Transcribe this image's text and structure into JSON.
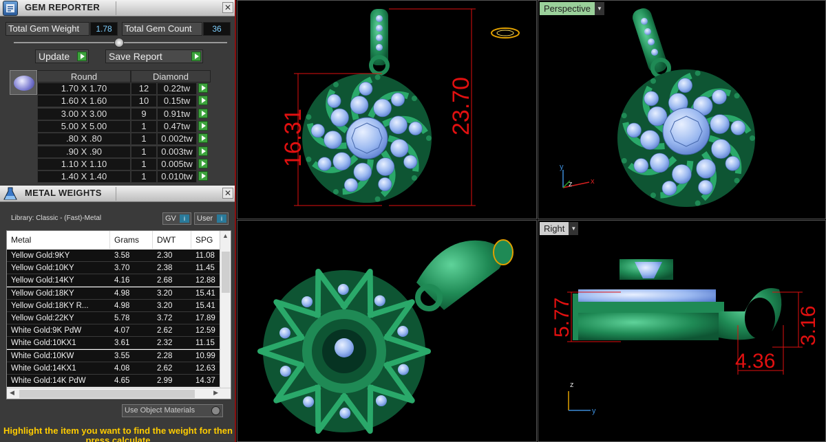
{
  "gem_reporter": {
    "title": "GEM REPORTER",
    "total_weight_label": "Total Gem Weight",
    "total_weight_value": "1.78",
    "total_count_label": "Total Gem Count",
    "total_count_value": "36",
    "update_label": "Update",
    "save_label": "Save Report",
    "shape_header": "Round",
    "type_header": "Diamond",
    "rows": [
      {
        "size": "1.70 X 1.70",
        "count": "12",
        "weight": "0.22tw"
      },
      {
        "size": "1.60 X 1.60",
        "count": "10",
        "weight": "0.15tw"
      },
      {
        "size": "3.00 X 3.00",
        "count": "9",
        "weight": "0.91tw"
      },
      {
        "size": "5.00 X 5.00",
        "count": "1",
        "weight": "0.47tw"
      },
      {
        "size": ".80 X .80",
        "count": "1",
        "weight": "0.002tw"
      },
      {
        "size": ".90 X .90",
        "count": "1",
        "weight": "0.003tw"
      },
      {
        "size": "1.10 X 1.10",
        "count": "1",
        "weight": "0.005tw"
      },
      {
        "size": "1.40 X 1.40",
        "count": "1",
        "weight": "0.010tw"
      }
    ]
  },
  "metal_weights": {
    "title": "METAL WEIGHTS",
    "library": "Library: Classic - (Fast)-Metal",
    "gv_label": "GV",
    "user_label": "User",
    "headers": [
      "Metal",
      "Grams",
      "DWT",
      "SPG"
    ],
    "rows": [
      [
        "Yellow Gold:9KY",
        "3.58",
        "2.30",
        "11.08"
      ],
      [
        "Yellow Gold:10KY",
        "3.70",
        "2.38",
        "11.45"
      ],
      [
        "Yellow Gold:14KY",
        "4.16",
        "2.68",
        "12.88"
      ],
      [
        "Yellow Gold:18KY",
        "4.98",
        "3.20",
        "15.41"
      ],
      [
        "Yellow Gold:18KY R...",
        "4.98",
        "3.20",
        "15.41"
      ],
      [
        "Yellow Gold:22KY",
        "5.78",
        "3.72",
        "17.89"
      ],
      [
        "White Gold:9K PdW",
        "4.07",
        "2.62",
        "12.59"
      ],
      [
        "White Gold:10KX1",
        "3.61",
        "2.32",
        "11.15"
      ],
      [
        "White Gold:10KW",
        "3.55",
        "2.28",
        "10.99"
      ],
      [
        "White Gold:14KX1",
        "4.08",
        "2.62",
        "12.63"
      ],
      [
        "White Gold:14K PdW",
        "4.65",
        "2.99",
        "14.37"
      ]
    ],
    "use_object_label": "Use Object Materials",
    "hint": "Highlight the item you want to find the weight for then press calculate"
  },
  "viewports": {
    "top": {
      "dim_left": "16.31",
      "dim_right": "23.70"
    },
    "perspective": {
      "label": "Perspective",
      "axis_x": "x",
      "axis_y": "y",
      "axis_z": "z"
    },
    "right": {
      "label": "Right",
      "dim_height": "5.77",
      "dim_bail": "3.16",
      "dim_width": "4.36",
      "axis_y": "y",
      "axis_z": "z"
    }
  },
  "colors": {
    "metal": "#1f8a55",
    "gem": "#9ab8f0",
    "dimension": "#e01010",
    "accent_green": "#3da33d"
  }
}
